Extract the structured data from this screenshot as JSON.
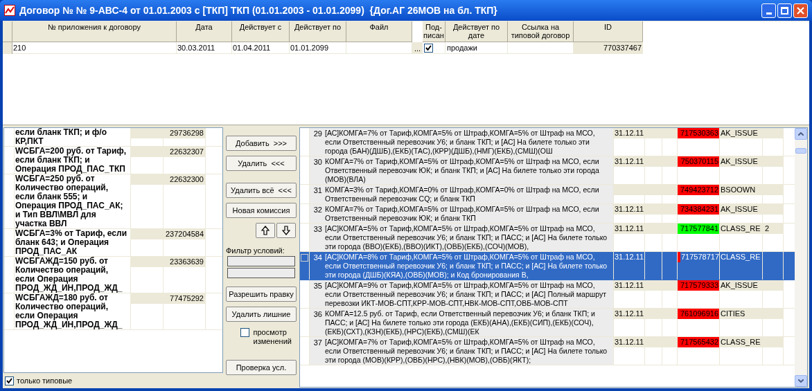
{
  "window": {
    "title": "Договор № № 9-АВС-4 от 01.01.2003 с [ТКП] ТКП (01.01.2003 - 01.01.2099)  {Дог.АГ 26МОВ на бл. ТКП}"
  },
  "top_grid": {
    "columns": [
      "№ приложения к договору",
      "Дата",
      "Действует с",
      "Действует по",
      "Файл",
      "Под-писан",
      "Действует по дате",
      "Ссылка на типовой договор",
      "ID"
    ],
    "rows": [
      {
        "number": "210",
        "date": "30.03.2011",
        "from": "01.04.2011",
        "to": "01.01.2099",
        "file_button": "...",
        "signed": true,
        "by_date": "продажи",
        "id": "770337467"
      }
    ]
  },
  "left_list": {
    "rows": [
      {
        "text": "если бланк ТКП; и ф/о КР,ПКТ",
        "id": "29736298"
      },
      {
        "text": "WCБГА=200 руб. от Тариф, если бланк ТКП; и Операция ПРОД_ПАС_ТКП",
        "id": "22632307"
      },
      {
        "text": "WCБГА=250 руб. от Количество операций, если бланк 555; и Операция ПРОД_ПАС_АК; и Тип ВВЛ\\МВЛ для участка ВВЛ",
        "id": "22632300"
      },
      {
        "text": "WCБГА=3% от Тариф, если бланк 643; и Операция ПРОД_ПАС_АК",
        "id": "237204584"
      },
      {
        "text": "WCБГАЖД=150 руб. от Количество операций, если Операция ПРОД_ЖД_ИН,ПРОД_ЖД_",
        "id": "23363639"
      },
      {
        "text": "WCБГАЖД=180 руб. от Количество операций, если Операция ПРОД_ЖД_ИН,ПРОД_ЖД_",
        "id": "77475292"
      }
    ]
  },
  "controls": [
    {
      "kind": "button",
      "label": "Добавить  >>>"
    },
    {
      "kind": "button",
      "label": "Удалить  <<<"
    },
    {
      "kind": "button",
      "label": "Удалить всё  <<<"
    },
    {
      "kind": "button",
      "label": "Новая комиссия"
    },
    {
      "kind": "arrows"
    },
    {
      "kind": "label",
      "label": "Фильтр условий:"
    },
    {
      "kind": "field"
    },
    {
      "kind": "field"
    },
    {
      "kind": "button",
      "label": "Разрешить правку"
    },
    {
      "kind": "button",
      "label": "Удалить лишние"
    },
    {
      "kind": "checkbox",
      "label": "просмотр изменений",
      "checked": false
    },
    {
      "kind": "button",
      "label": "Проверка усл."
    }
  ],
  "right_table": {
    "rows": [
      {
        "num": "29",
        "text": "[АС]КОМГА=7% от Тариф,КОМГА=5% от Штраф,КОМГА=5% от Штраф на МСО, если Ответственный перевозчик У6; и бланк ТКП; и [АС] На билете только эти города (БАН)(ДШБ),(ЕКБ)(ТАС),(КРР)(ДШБ),(НМГ)(ЕКБ),(СМШ)(ОШ",
        "date": "31.12.11",
        "id": "717530363",
        "color": "#ff0000",
        "code": "AK_ISSUE",
        "selected": false
      },
      {
        "num": "30",
        "text": "КОМГА=7% от Тариф,КОМГА=5% от Штраф,КОМГА=5% от Штраф на МСО, если Ответственный перевозчик ЮК; и бланк ТКП; и [АС] На билете только эти города (МОВ)(ВЛА)",
        "date": "31.12.11",
        "id": "750370115",
        "color": "#ff0000",
        "code": "AK_ISSUE",
        "selected": false
      },
      {
        "num": "31",
        "text": "КОМГА=3% от Тариф,КОМГА=0% от Штраф,КОМГА=0% от Штраф на МСО, если Ответственный перевозчик CQ; и бланк ТКП",
        "id": "749423712",
        "color": "#ff0000",
        "code": "BSOOWN",
        "selected": false
      },
      {
        "num": "32",
        "text": "КОМГА=7% от Тариф,КОМГА=5% от Штраф,КОМГА=5% от Штраф на МСО, если Ответственный перевозчик ЮК; и бланк ТКП",
        "date": "31.12.11",
        "id": "734384231",
        "color": "#ff0000",
        "code": "AK_ISSUE",
        "selected": false
      },
      {
        "num": "33",
        "text": "[АС]КОМГА=5% от Тариф,КОМГА=5% от Штраф,КОМГА=5% от Штраф на МСО, если Ответственный перевозчик У6; и бланк ТКП; и ПАСС; и [АС] На билете только эти города (ВВО)(ЕКБ),(ВВО)(ИКТ),(ОВБ)(ЕКБ),(СОЧ)(МОВ),",
        "date": "31.12.11",
        "id": "717577841",
        "color": "#00ff00",
        "code": "CLASS_RE",
        "extra": "2",
        "selected": false
      },
      {
        "num": "34",
        "text": "[АС]КОМГА=8% от Тариф,КОМГА=5% от Штраф,КОМГА=5% от Штраф на МСО, если Ответственный перевозчик У6; и бланк ТКП; и ПАСС; и [АС] На билете только эти города (ДШБ)(КЯА),(ОВБ)(МОВ); и Код бронирования В,",
        "date": "31.12.11",
        "id": "717578717",
        "color": "#ff0000",
        "code": "CLASS_RE",
        "selected": true
      },
      {
        "num": "35",
        "text": "[АС]КОМГА=9% от Тариф,КОМГА=5% от Штраф,КОМГА=5% от Штраф на МСО, если Ответственный перевозчик У6; и бланк ТКП; и ПАСС; и [АС] Полный маршрут перевозки ИКТ-МОВ-СПТ,КРР-МОВ-СПТ,НВК-МОВ-СПТ,ОВБ-МОВ-СПТ",
        "date": "31.12.11",
        "id": "717579333",
        "color": "#ff0000",
        "code": "AK_ISSUE",
        "selected": false
      },
      {
        "num": "36",
        "text": "КОМГА=12.5 руб. от Тариф, если Ответственный перевозчик У6; и бланк ТКП; и ПАСС; и [АС] На билете только эти города (ЕКБ)(АНА),(ЕКБ)(СИП),(ЕКБ)(СОЧ),(ЕКБ)(СХТ),(КЗН)(ЕКБ),(НРС)(ЕКБ),(СМШ)(ЕК",
        "date": "31.12.11",
        "id": "761096916",
        "color": "#ff0000",
        "code": "CITIES",
        "selected": false
      },
      {
        "num": "37",
        "text": "[АС]КОМГА=7% от Тариф,КОМГА=5% от Штраф,КОМГА=5% от Штраф на МСО, если Ответственный перевозчик У6; и бланк ТКП; и ПАСС; и [АС] На билете только эти города (МОВ)(КРР),(ОВБ)(НРС),(НВК)(МОВ),(ОВБ)(ЯКТ);",
        "date": "31.12.11",
        "id": "717565432",
        "color": "#ff0000",
        "code": "CLASS_RE",
        "selected": false
      }
    ]
  },
  "bottom_checkbox": {
    "label": "только типовые",
    "checked": true
  }
}
